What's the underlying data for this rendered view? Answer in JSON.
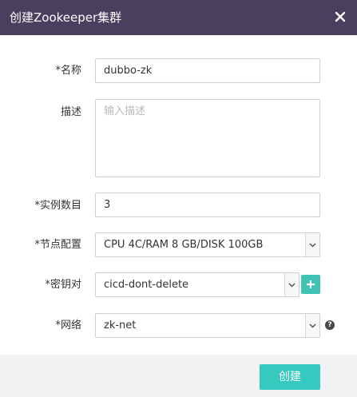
{
  "dialog": {
    "title": "创建Zookeeper集群",
    "create_label": "创建"
  },
  "form": {
    "name": {
      "label": "*名称",
      "value": "dubbo-zk"
    },
    "description": {
      "label": "描述",
      "placeholder": "输入描述"
    },
    "instances": {
      "label": "*实例数目",
      "value": "3"
    },
    "node_config": {
      "label": "*节点配置",
      "value": "CPU 4C/RAM 8 GB/DISK 100GB"
    },
    "keypair": {
      "label": "*密钥对",
      "value": "cicd-dont-delete"
    },
    "network": {
      "label": "*网络",
      "value": "zk-net"
    }
  },
  "icons": {
    "close": "close-icon",
    "add": "plus-icon",
    "help": "question-circle-icon",
    "dropdown": "chevron-down-icon"
  },
  "colors": {
    "titlebar": "#4a3f5e",
    "accent": "#36c9c0",
    "add_button": "#3ec3b5",
    "footer": "#f2f2f5"
  }
}
